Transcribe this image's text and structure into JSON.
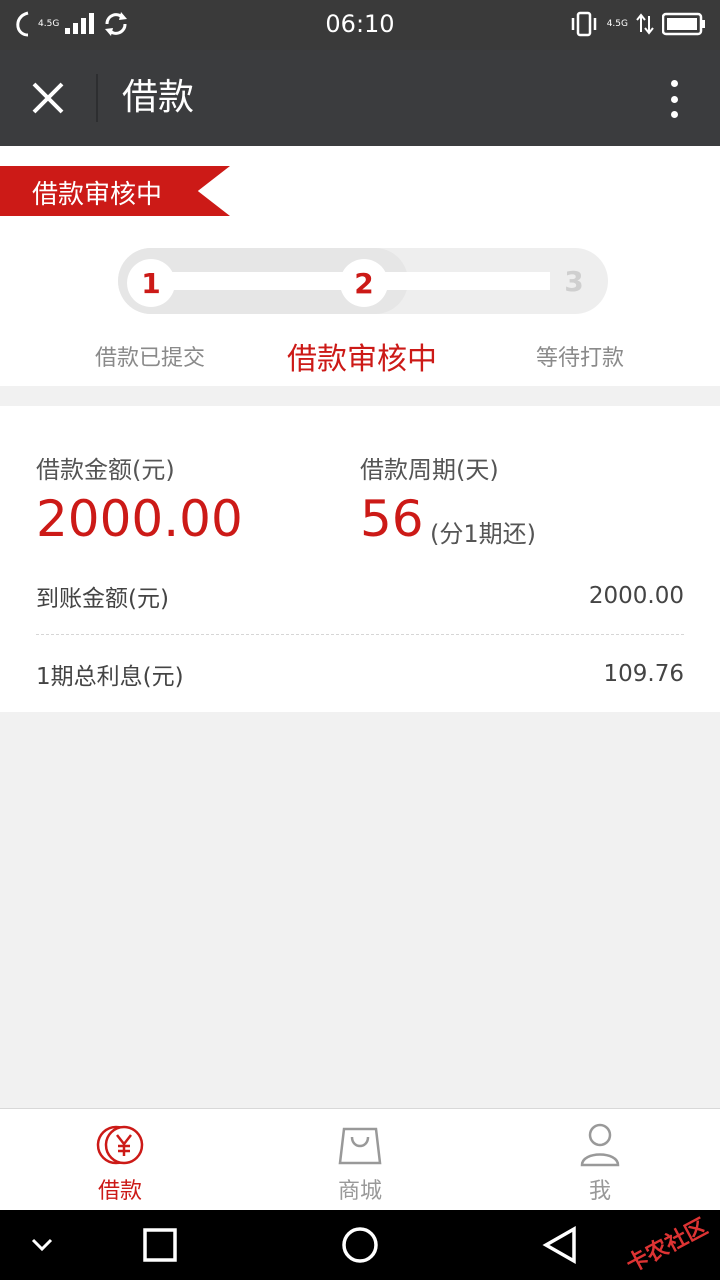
{
  "status_bar": {
    "time": "06:10",
    "left_network": "4.5G",
    "right_network": "4.5G"
  },
  "title_bar": {
    "title": "借款"
  },
  "progress": {
    "ribbon": "借款审核中",
    "steps": [
      {
        "number": "1",
        "label": "借款已提交",
        "state": "done"
      },
      {
        "number": "2",
        "label": "借款审核中",
        "state": "active"
      },
      {
        "number": "3",
        "label": "等待打款",
        "state": "todo"
      }
    ]
  },
  "loan": {
    "amount_label": "借款金额(元)",
    "amount": "2000.00",
    "period_label": "借款周期(天)",
    "period": "56",
    "period_note": "(分1期还)",
    "received_label": "到账金额(元)",
    "received": "2000.00",
    "interest_label": "1期总利息(元)",
    "interest": "109.76"
  },
  "bottom_nav": {
    "items": [
      {
        "label": "借款",
        "icon": "yen-coin-icon",
        "active": true
      },
      {
        "label": "商城",
        "icon": "shopping-bag-icon",
        "active": false
      },
      {
        "label": "我",
        "icon": "user-icon",
        "active": false
      }
    ]
  },
  "watermark": "卡农社区",
  "colors": {
    "accent": "#cc1a17",
    "title_bar": "#3b3c3e",
    "status_bar": "#3a3a3a"
  }
}
